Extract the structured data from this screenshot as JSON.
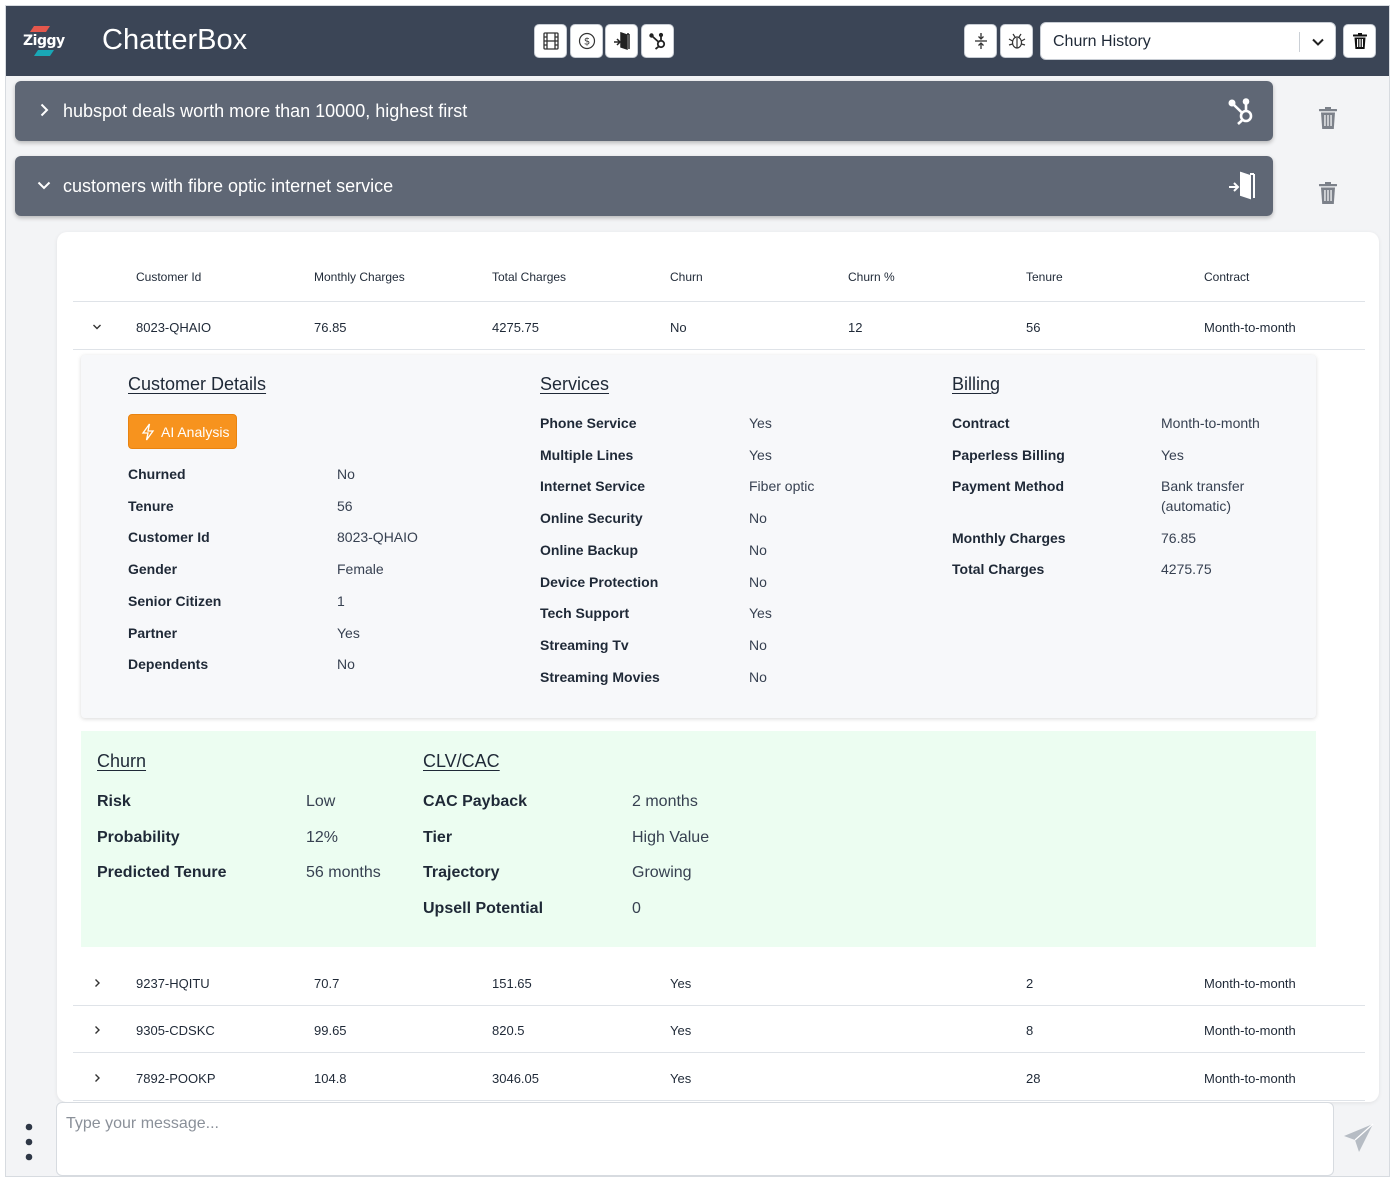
{
  "app": {
    "logo_text": "Ziggy",
    "title": "ChatterBox"
  },
  "toolbar": {
    "buttons": [
      "film-icon",
      "dollar-icon",
      "door-exit-icon",
      "hubspot-icon"
    ],
    "right_buttons": [
      "compress-icon",
      "bug-icon",
      "trash-icon"
    ],
    "select_value": "Churn History"
  },
  "queries": [
    {
      "text": "hubspot deals worth more than 10000, highest first",
      "expanded": false,
      "icon": "hubspot-icon"
    },
    {
      "text": "customers with fibre optic internet service",
      "expanded": true,
      "icon": "door-exit-icon"
    }
  ],
  "table": {
    "headers": [
      "Customer Id",
      "Monthly Charges",
      "Total Charges",
      "Churn",
      "Churn %",
      "Tenure",
      "Contract"
    ],
    "rows": [
      {
        "id": "8023-QHAIO",
        "monthly": "76.85",
        "total": "4275.75",
        "churn": "No",
        "churn_pct": "12",
        "tenure": "56",
        "contract": "Month-to-month",
        "expanded": true
      },
      {
        "id": "9237-HQITU",
        "monthly": "70.7",
        "total": "151.65",
        "churn": "Yes",
        "churn_pct": "",
        "tenure": "2",
        "contract": "Month-to-month",
        "expanded": false
      },
      {
        "id": "9305-CDSKC",
        "monthly": "99.65",
        "total": "820.5",
        "churn": "Yes",
        "churn_pct": "",
        "tenure": "8",
        "contract": "Month-to-month",
        "expanded": false
      },
      {
        "id": "7892-POOKP",
        "monthly": "104.8",
        "total": "3046.05",
        "churn": "Yes",
        "churn_pct": "",
        "tenure": "28",
        "contract": "Month-to-month",
        "expanded": false
      }
    ]
  },
  "details": {
    "customer": {
      "title": "Customer Details",
      "ai_button": "AI Analysis",
      "fields": [
        [
          "Churned",
          "No"
        ],
        [
          "Tenure",
          "56"
        ],
        [
          "Customer Id",
          "8023-QHAIO"
        ],
        [
          "Gender",
          "Female"
        ],
        [
          "Senior Citizen",
          "1"
        ],
        [
          "Partner",
          "Yes"
        ],
        [
          "Dependents",
          "No"
        ]
      ]
    },
    "services": {
      "title": "Services",
      "fields": [
        [
          "Phone Service",
          "Yes"
        ],
        [
          "Multiple Lines",
          "Yes"
        ],
        [
          "Internet Service",
          "Fiber optic"
        ],
        [
          "Online Security",
          "No"
        ],
        [
          "Online Backup",
          "No"
        ],
        [
          "Device Protection",
          "No"
        ],
        [
          "Tech Support",
          "Yes"
        ],
        [
          "Streaming Tv",
          "No"
        ],
        [
          "Streaming Movies",
          "No"
        ]
      ]
    },
    "billing": {
      "title": "Billing",
      "fields": [
        [
          "Contract",
          "Month-to-month"
        ],
        [
          "Paperless Billing",
          "Yes"
        ],
        [
          "Payment Method",
          "Bank transfer (automatic)"
        ],
        [
          "Monthly Charges",
          "76.85"
        ],
        [
          "Total Charges",
          "4275.75"
        ]
      ]
    }
  },
  "insights": {
    "churn": {
      "title": "Churn",
      "fields": [
        [
          "Risk",
          "Low"
        ],
        [
          "Probability",
          "12%"
        ],
        [
          "Predicted Tenure",
          "56 months"
        ]
      ]
    },
    "clv": {
      "title": "CLV/CAC",
      "fields": [
        [
          "CAC Payback",
          "2 months"
        ],
        [
          "Tier",
          "High Value"
        ],
        [
          "Trajectory",
          "Growing"
        ],
        [
          "Upsell Potential",
          "0"
        ]
      ]
    }
  },
  "composer": {
    "placeholder": "Type your message..."
  },
  "colors": {
    "header": "#3b4556",
    "query_bar": "#5f6775",
    "accent": "#f7931e",
    "insight_bg": "#ecfdf1"
  }
}
